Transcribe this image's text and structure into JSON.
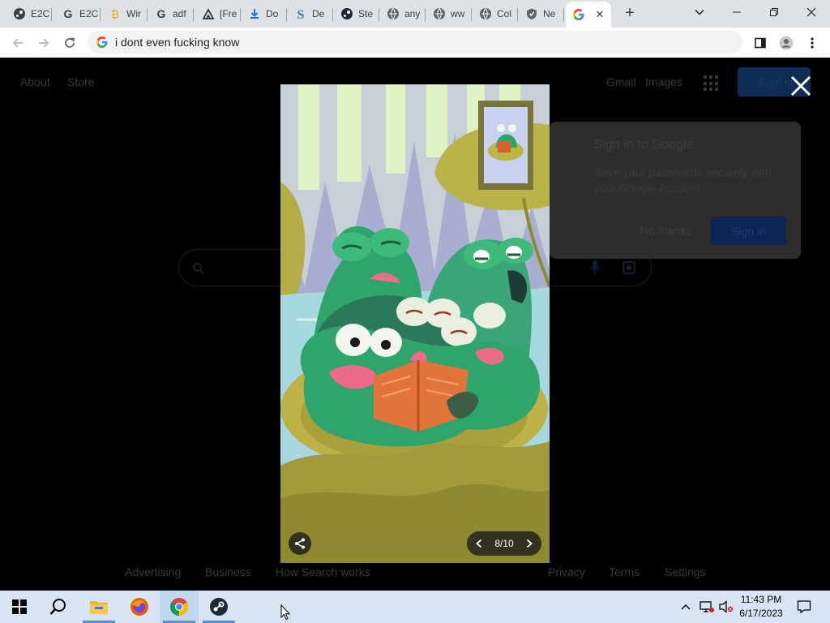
{
  "browser": {
    "tabs": [
      {
        "label": "E2C",
        "icon": "steam-icon"
      },
      {
        "label": "E2C",
        "icon": "google-g-icon"
      },
      {
        "label": "Wir",
        "icon": "bitcoin-icon"
      },
      {
        "label": "adf",
        "icon": "google-g-icon"
      },
      {
        "label": "[Fre",
        "icon": "triangle-site-icon"
      },
      {
        "label": "Do",
        "icon": "download-icon"
      },
      {
        "label": "De",
        "icon": "s-site-icon"
      },
      {
        "label": "Ste",
        "icon": "steam-icon"
      },
      {
        "label": "any",
        "icon": "globe-icon"
      },
      {
        "label": "ww",
        "icon": "globe-icon"
      },
      {
        "label": "Col",
        "icon": "globe-icon"
      },
      {
        "label": "Ne",
        "icon": "shield-icon"
      }
    ],
    "active_tab_close": "✕",
    "new_tab": "+",
    "address_text": "i dont even fucking know"
  },
  "page": {
    "links_left": [
      "About",
      "Store"
    ],
    "links_right": [
      "Gmail",
      "Images"
    ],
    "signin_label": "Sign in",
    "popup": {
      "title": "Sign in to Google",
      "body": "Save your passwords securely with your Google Account",
      "no_thanks": "No thanks",
      "sign_in": "Sign in"
    },
    "footer_left": [
      "Advertising",
      "Business",
      "How Search works"
    ],
    "footer_right": [
      "Privacy",
      "Terms",
      "Settings"
    ]
  },
  "lightbox": {
    "counter": "8/10"
  },
  "taskbar": {
    "time": "11:43 PM",
    "date": "6/17/2023"
  },
  "colors": {
    "accent_blue": "#1a73e8",
    "taskbar_bg": "#d6e4f3",
    "tabstrip_bg": "#dee1e6"
  }
}
